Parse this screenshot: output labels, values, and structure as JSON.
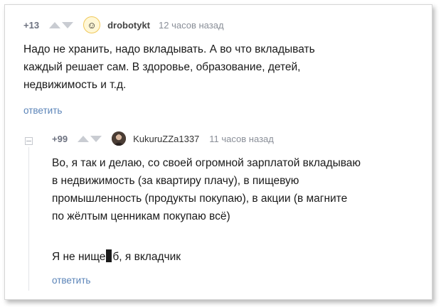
{
  "comment1": {
    "rating": "+13",
    "username": "drobotykt",
    "time": "12 часов назад",
    "lines": [
      "Надо не хранить, надо вкладывать. А во что вкладывать",
      "каждый решает сам. В здоровье, образование, детей,",
      "недвижимость и т.д."
    ],
    "reply_label": "ответить"
  },
  "comment2": {
    "rating": "+99",
    "username": "KukuruZZa1337",
    "time": "11 часов назад",
    "lines": [
      "Во, я так и делаю, со своей огромной зарплатой вкладываю",
      "в недвижимость (за квартиру плачу), в пищевую",
      "промышленность (продукты покупаю), в акции (в магните",
      "по жёлтым ценникам покупаю всё)"
    ],
    "last_line_before": "Я не нище",
    "last_line_after": "б, я вкладчик",
    "reply_label": "ответить"
  },
  "icons": {
    "avatar1": "smiley-avatar-icon",
    "avatar2": "user-photo-avatar-icon",
    "vote_up": "triangle-up-icon",
    "vote_down": "triangle-down-icon",
    "collapse": "collapse-thread-icon"
  },
  "colors": {
    "link": "#5b84b8",
    "vote_arrow": "#c9ccd2",
    "meta_text": "#8a8f98"
  }
}
